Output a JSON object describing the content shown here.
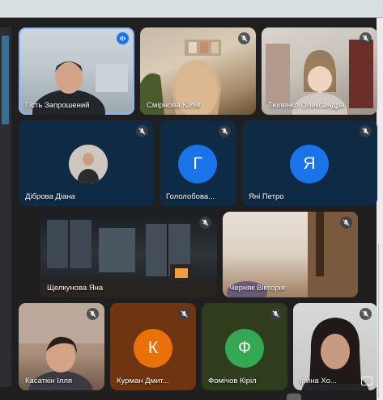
{
  "participants": [
    {
      "name": "Гість Запрошений",
      "mic": "speaking",
      "avatar_letter": "",
      "color": "#8ab4f8"
    },
    {
      "name": "Смірнова Юлія",
      "mic": "muted",
      "avatar_letter": ""
    },
    {
      "name": "Тюленко Олександра",
      "mic": "muted",
      "avatar_letter": ""
    },
    {
      "name": "Діброва Діана",
      "mic": "muted",
      "avatar_letter": ""
    },
    {
      "name": "Гололобова...",
      "mic": "muted",
      "avatar_letter": "Г",
      "color": "#1a73e8"
    },
    {
      "name": "Яні Петро",
      "mic": "muted",
      "avatar_letter": "Я",
      "color": "#1a73e8"
    },
    {
      "name": "Щелкунова Яна",
      "mic": "muted",
      "avatar_letter": ""
    },
    {
      "name": "Черняк Вікторія",
      "mic": "muted",
      "avatar_letter": ""
    },
    {
      "name": "Касаткін Ілля",
      "mic": "muted",
      "avatar_letter": ""
    },
    {
      "name": "Курман Дмит...",
      "mic": "muted",
      "avatar_letter": "К",
      "color": "#e8710a"
    },
    {
      "name": "Фомічов Кіріл",
      "mic": "muted",
      "avatar_letter": "Ф",
      "color": "#34a853"
    },
    {
      "name": "Ірина Хо...",
      "mic": "muted",
      "avatar_letter": ""
    }
  ]
}
